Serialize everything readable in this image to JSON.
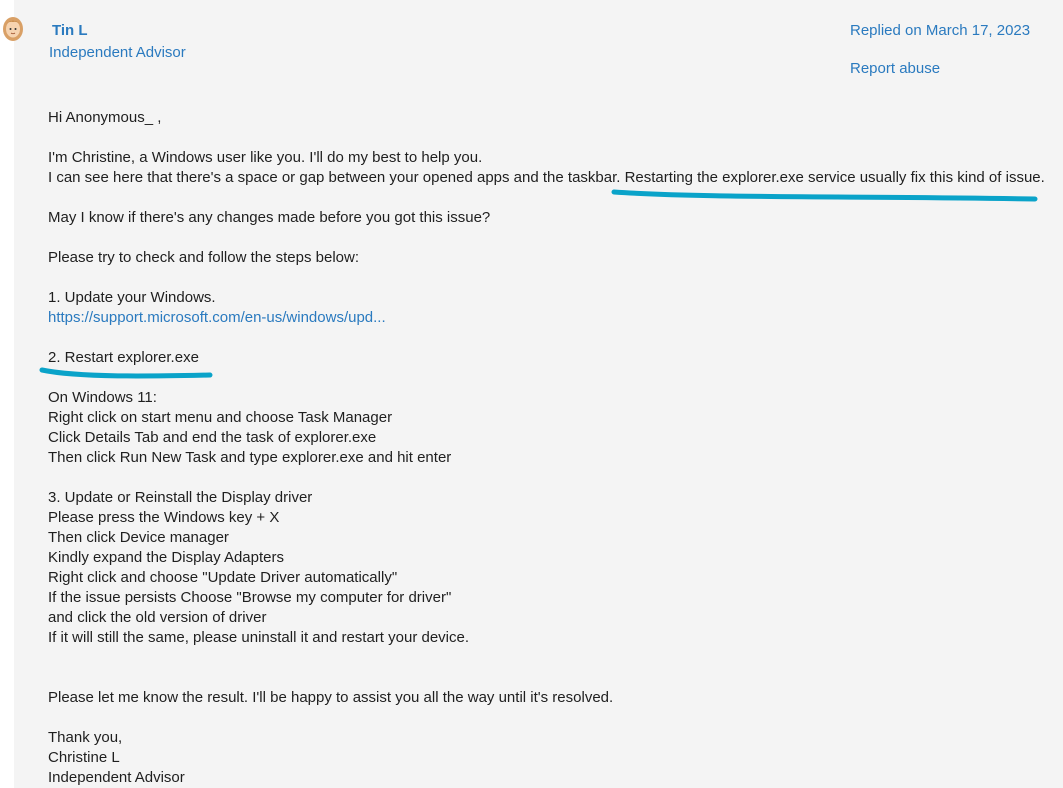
{
  "author": {
    "name": "Tin L",
    "role": "Independent Advisor",
    "avatar_icon": "user-avatar-icon"
  },
  "meta": {
    "replied": "Replied on March 17, 2023",
    "report": "Report abuse"
  },
  "colors": {
    "link": "#2a7abf",
    "annotation": "#0aa3c9",
    "card_bg": "#f4f4f4"
  },
  "message": {
    "greeting": "Hi Anonymous_ ,",
    "intro1": "I'm Christine, a Windows user like you. I'll do my best to help you.",
    "intro2": "I can see here that there's a space or gap between your opened apps and the taskbar. Restarting the explorer.exe service usually fix this kind of issue.",
    "question": "May I know if there's any changes made before you got this issue?",
    "steps_intro": "Please try to check and follow the steps below:",
    "step1": "1. Update your Windows.",
    "step1_link": "https://support.microsoft.com/en-us/windows/upd...",
    "step2": "2. Restart explorer.exe",
    "step2_lines": [
      "On Windows 11:",
      "Right click on start menu and choose Task Manager",
      "Click Details Tab and end the task of explorer.exe",
      "Then click Run New Task and type explorer.exe and hit enter"
    ],
    "step3": "3. Update or Reinstall the Display driver",
    "step3_lines": [
      "Please press the Windows key + X",
      "Then click Device manager",
      "Kindly expand the Display Adapters",
      "Right click and choose \"Update Driver automatically\"",
      "If the issue persists Choose \"Browse my computer for driver\"",
      "and click the old version of driver",
      "If it will still the same, please uninstall it and restart your device."
    ],
    "closing": "Please let me know the result. I'll be happy to assist you all the way until it's resolved.",
    "signoff": [
      "Thank you,",
      "Christine L",
      "Independent Advisor"
    ]
  }
}
